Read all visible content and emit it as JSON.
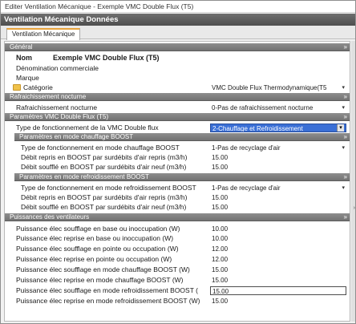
{
  "window": {
    "title": "Editer Ventilation Mécanique - Exemple VMC Double Flux (T5)"
  },
  "header": {
    "title": "Ventilation Mécanique Données"
  },
  "tabs": [
    {
      "label": "Ventilation Mécanique"
    }
  ],
  "sections": {
    "general": "Général",
    "rafraichissement": "Rafraichissement nocturne",
    "parametres": "Paramètres VMC Double Flux (T5)",
    "boost_chauffage": "Paramètres en mode chauffage BOOST",
    "boost_refroid": "Paramètres en mode refroidissement BOOST",
    "puissances": "Puissances des ventilateurs"
  },
  "general": {
    "nom_label": "Nom",
    "nom_value": "Exemple VMC Double Flux (T5)",
    "denomination_label": "Dénomination commerciale",
    "marque_label": "Marque",
    "categorie_label": "Catégorie",
    "categorie_value": "VMC Double Flux Thermodynamique(T5"
  },
  "rafraichissement": {
    "label": "Rafraichissement nocturne",
    "value": "0-Pas de rafraichissement nocturne"
  },
  "parametres": {
    "type_label": "Type de fonctionnement de la VMC Double flux",
    "type_value": "2-Chauffage et Refroidissement"
  },
  "boost_chauffage": {
    "type_label": "Type de fonctionnement en mode chauffage BOOST",
    "type_value": "1-Pas de recyclage d'air",
    "debit_repris_label": "Débit repris en BOOST par surdébits d'air repris (m3/h)",
    "debit_repris_value": "15.00",
    "debit_souffle_label": "Débit soufflé en BOOST par surdébits d'air neuf (m3/h)",
    "debit_souffle_value": "15.00"
  },
  "boost_refroid": {
    "type_label": "Type de fonctionnement en mode refroidissement BOOST",
    "type_value": "1-Pas de recyclage d'air",
    "debit_repris_label": "Débit repris en BOOST par surdébits d'air repris (m3/h)",
    "debit_repris_value": "15.00",
    "debit_souffle_label": "Débit soufflé en BOOST par surdébits d'air neuf (m3/h)",
    "debit_souffle_value": "15.00"
  },
  "puissances": [
    {
      "label": "Puissance élec soufflage en base ou inoccupation (W)",
      "value": "10.00"
    },
    {
      "label": "Puissance élec reprise en base ou inoccupation (W)",
      "value": "10.00"
    },
    {
      "label": "Puissance élec soufflage en pointe ou occupation (W)",
      "value": "12.00"
    },
    {
      "label": "Puissance élec reprise en pointe ou occupation (W)",
      "value": "12.00"
    },
    {
      "label": "Puissance élec soufflage en mode chauffage BOOST (W)",
      "value": "15.00"
    },
    {
      "label": "Puissance élec reprise en mode chauffage BOOST (W)",
      "value": "15.00"
    },
    {
      "label": "Puissance élec soufflage en mode refroidissement BOOST (",
      "value": "15.00"
    },
    {
      "label": "Puissance élec reprise en mode refroidissement BOOST (W)",
      "value": "15.00"
    }
  ],
  "icons": {
    "collapse": "chevron-double-up-icon",
    "dropdown": "dropdown-arrow-icon",
    "folder": "folder-icon"
  }
}
